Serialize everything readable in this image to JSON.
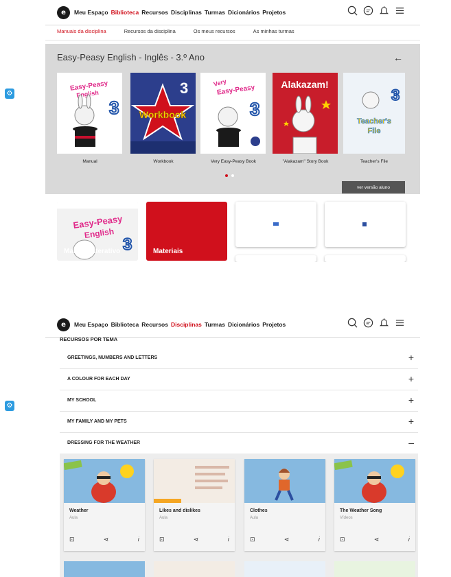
{
  "nav": {
    "logo": "e",
    "links_top": [
      "Meu Espaço",
      "Biblioteca",
      "Recursos",
      "Disciplinas",
      "Turmas",
      "Dicionários",
      "Projetos"
    ],
    "active_top": "Biblioteca",
    "links_bottom": [
      "Meu Espaço",
      "Biblioteca",
      "Recursos",
      "Disciplinas",
      "Turmas",
      "Dicionários",
      "Projetos"
    ],
    "active_bottom": "Disciplinas"
  },
  "subtabs": [
    "Manuais da disciplina",
    "Recursos da disciplina",
    "Os meus recursos",
    "As minhas turmas"
  ],
  "panel": {
    "title": "Easy-Peasy English - Inglês - 3.º Ano",
    "books": [
      {
        "label": "Manual",
        "cover": "Easy-Peasy English 3"
      },
      {
        "label": "Workbook",
        "cover": "Workbook"
      },
      {
        "label": "Very Easy-Peasy Book",
        "cover": "Very Easy-Peasy"
      },
      {
        "label": "\"Alakazam\" Story Book",
        "cover": "Alakazam!"
      },
      {
        "label": "Teacher's File",
        "cover": "Teacher's File"
      }
    ],
    "student_button": "ver versão aluno"
  },
  "cards": {
    "manual_interativo": "Manual Interativo",
    "materiais": "Materiais"
  },
  "resources": {
    "section_title": "RECURSOS POR TEMA",
    "themes": [
      {
        "label": "GREETINGS, NUMBERS AND LETTERS",
        "sign": "+"
      },
      {
        "label": "A COLOUR FOR EACH DAY",
        "sign": "+"
      },
      {
        "label": "MY SCHOOL",
        "sign": "+"
      },
      {
        "label": "MY FAMILY AND MY PETS",
        "sign": "+"
      },
      {
        "label": "DRESSING FOR THE WEATHER",
        "sign": "–"
      }
    ],
    "items": [
      {
        "title": "Weather",
        "type": "Aula"
      },
      {
        "title": "Likes and dislikes",
        "type": "Aula"
      },
      {
        "title": "Clothes",
        "type": "Aula"
      },
      {
        "title": "The Weather Song",
        "type": "Vídeos"
      }
    ]
  },
  "colors": {
    "brand_red": "#d0101c",
    "panel_gray": "#d9d9d9",
    "settings_blue": "#2c9be0"
  }
}
